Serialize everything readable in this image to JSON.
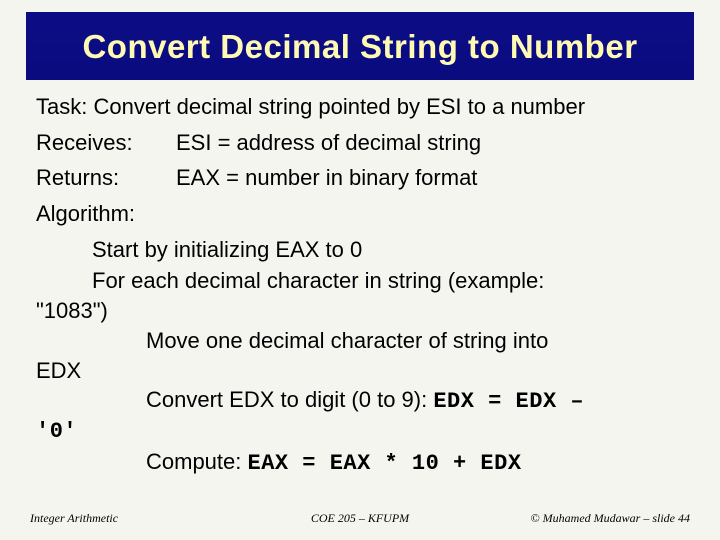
{
  "title": "Convert Decimal String to Number",
  "task": "Task: Convert decimal string pointed by ESI to a number",
  "receives": {
    "label": "Receives:",
    "value": "ESI = address of decimal string"
  },
  "returns": {
    "label": "Returns:",
    "value": "EAX = number in binary format"
  },
  "algorithm_label": "Algorithm:",
  "algo": {
    "line1": "Start by initializing EAX to 0",
    "line2a": "For each decimal character in string (example:",
    "line2b": "\"1083\")",
    "line3a": "Move one decimal character of string into",
    "line3b": "EDX",
    "line4a": "Convert EDX to digit (0 to 9): ",
    "line4a_code": "EDX = EDX –",
    "line4b_code": "'0'",
    "line5a": "Compute: ",
    "line5a_code": "EAX = EAX * 10 + EDX"
  },
  "footer": {
    "left": "Integer Arithmetic",
    "center": "COE 205 – KFUPM",
    "right": "© Muhamed Mudawar – slide 44"
  }
}
